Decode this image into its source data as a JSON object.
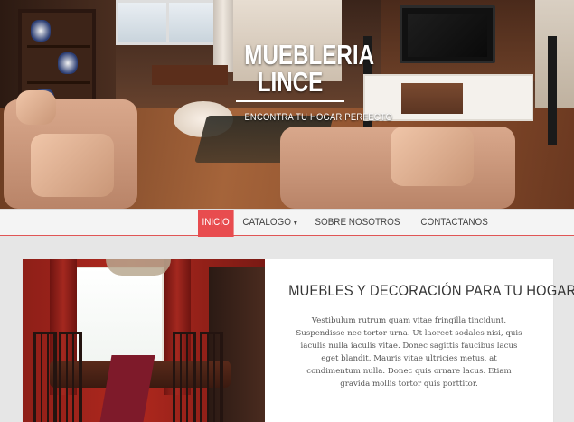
{
  "hero": {
    "title_line1": "MUEBLERIA",
    "title_line2": "LINCE",
    "tagline": "ENCONTRA TU HOGAR PERFECTO"
  },
  "nav": {
    "items": [
      {
        "label": "INICIO",
        "active": true
      },
      {
        "label": "CATALOGO",
        "has_dropdown": true
      },
      {
        "label": "SOBRE NOSOTROS"
      },
      {
        "label": "CONTACTANOS"
      }
    ]
  },
  "feature": {
    "heading": "MUEBLES Y DECORACIÓN PARA TU HOGAR.",
    "body": "Vestibulum rutrum quam vitae fringilla tincidunt. Suspendisse nec tortor urna. Ut laoreet sodales nisi, quis iaculis nulla iaculis vitae. Donec sagittis faucibus lacus eget blandit. Mauris vitae ultricies metus, at condimentum nulla. Donec quis ornare lacus. Etiam gravida mollis tortor quis porttitor."
  },
  "colors": {
    "accent": "#e84c4f",
    "nav_background": "#f4f4f4",
    "page_background": "#e6e6e6"
  },
  "icons": {
    "dropdown": "caret-down-icon"
  }
}
